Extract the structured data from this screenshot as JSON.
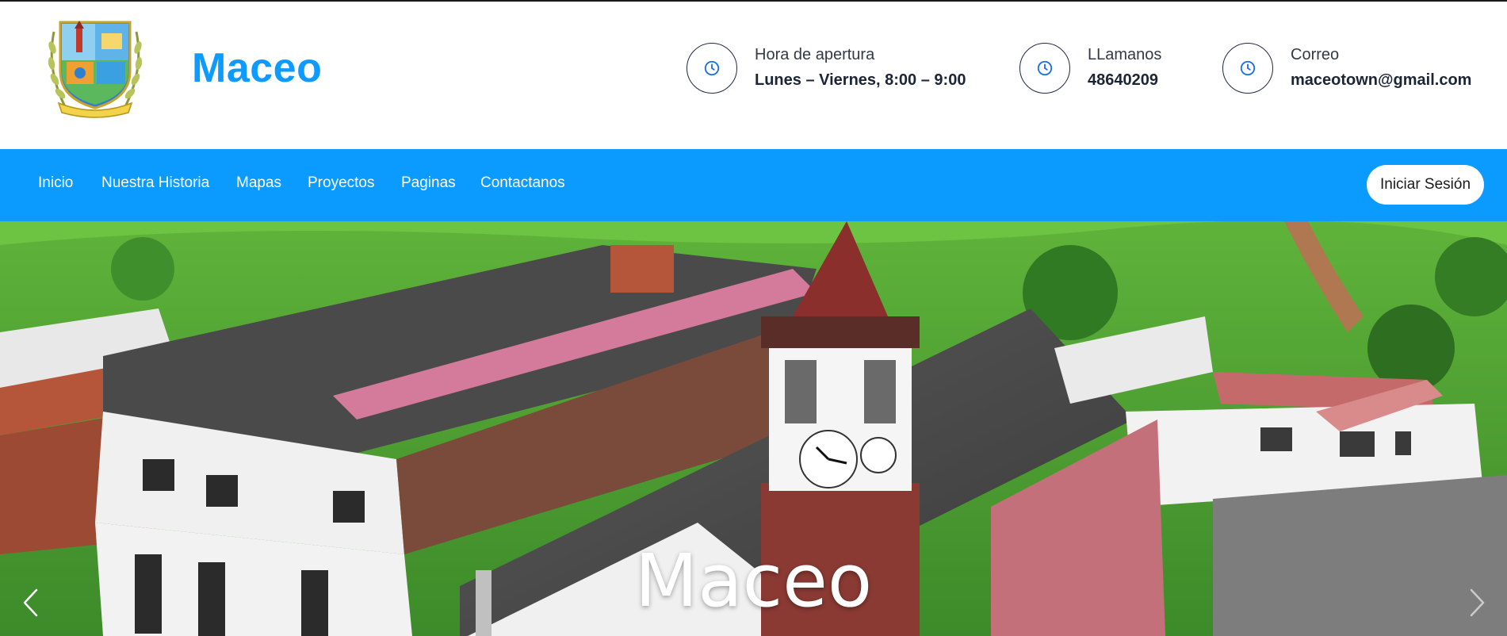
{
  "site": {
    "name": "Maceo",
    "logo_icon": "coat-of-arms-icon"
  },
  "contact": [
    {
      "icon": "clock-icon",
      "label": "Hora de apertura",
      "value": "Lunes – Viernes, 8:00 – 9:00"
    },
    {
      "icon": "clock-icon",
      "label": "LLamanos",
      "value": "48640209"
    },
    {
      "icon": "clock-icon",
      "label": "Correo",
      "value": "maceotown@gmail.com"
    }
  ],
  "nav": {
    "items": [
      "Inicio",
      "Nuestra Historia",
      "Mapas",
      "Proyectos",
      "Paginas",
      "Contactanos"
    ],
    "login_label": "Iniciar Sesión"
  },
  "hero": {
    "title": "Maceo",
    "prev_icon": "chevron-left-icon",
    "next_icon": "chevron-right-icon"
  },
  "colors": {
    "brand": "#0b9bff",
    "nav_text": "#ffffff",
    "header_bg": "#ffffff",
    "icon_blue": "#1a6fe0"
  }
}
